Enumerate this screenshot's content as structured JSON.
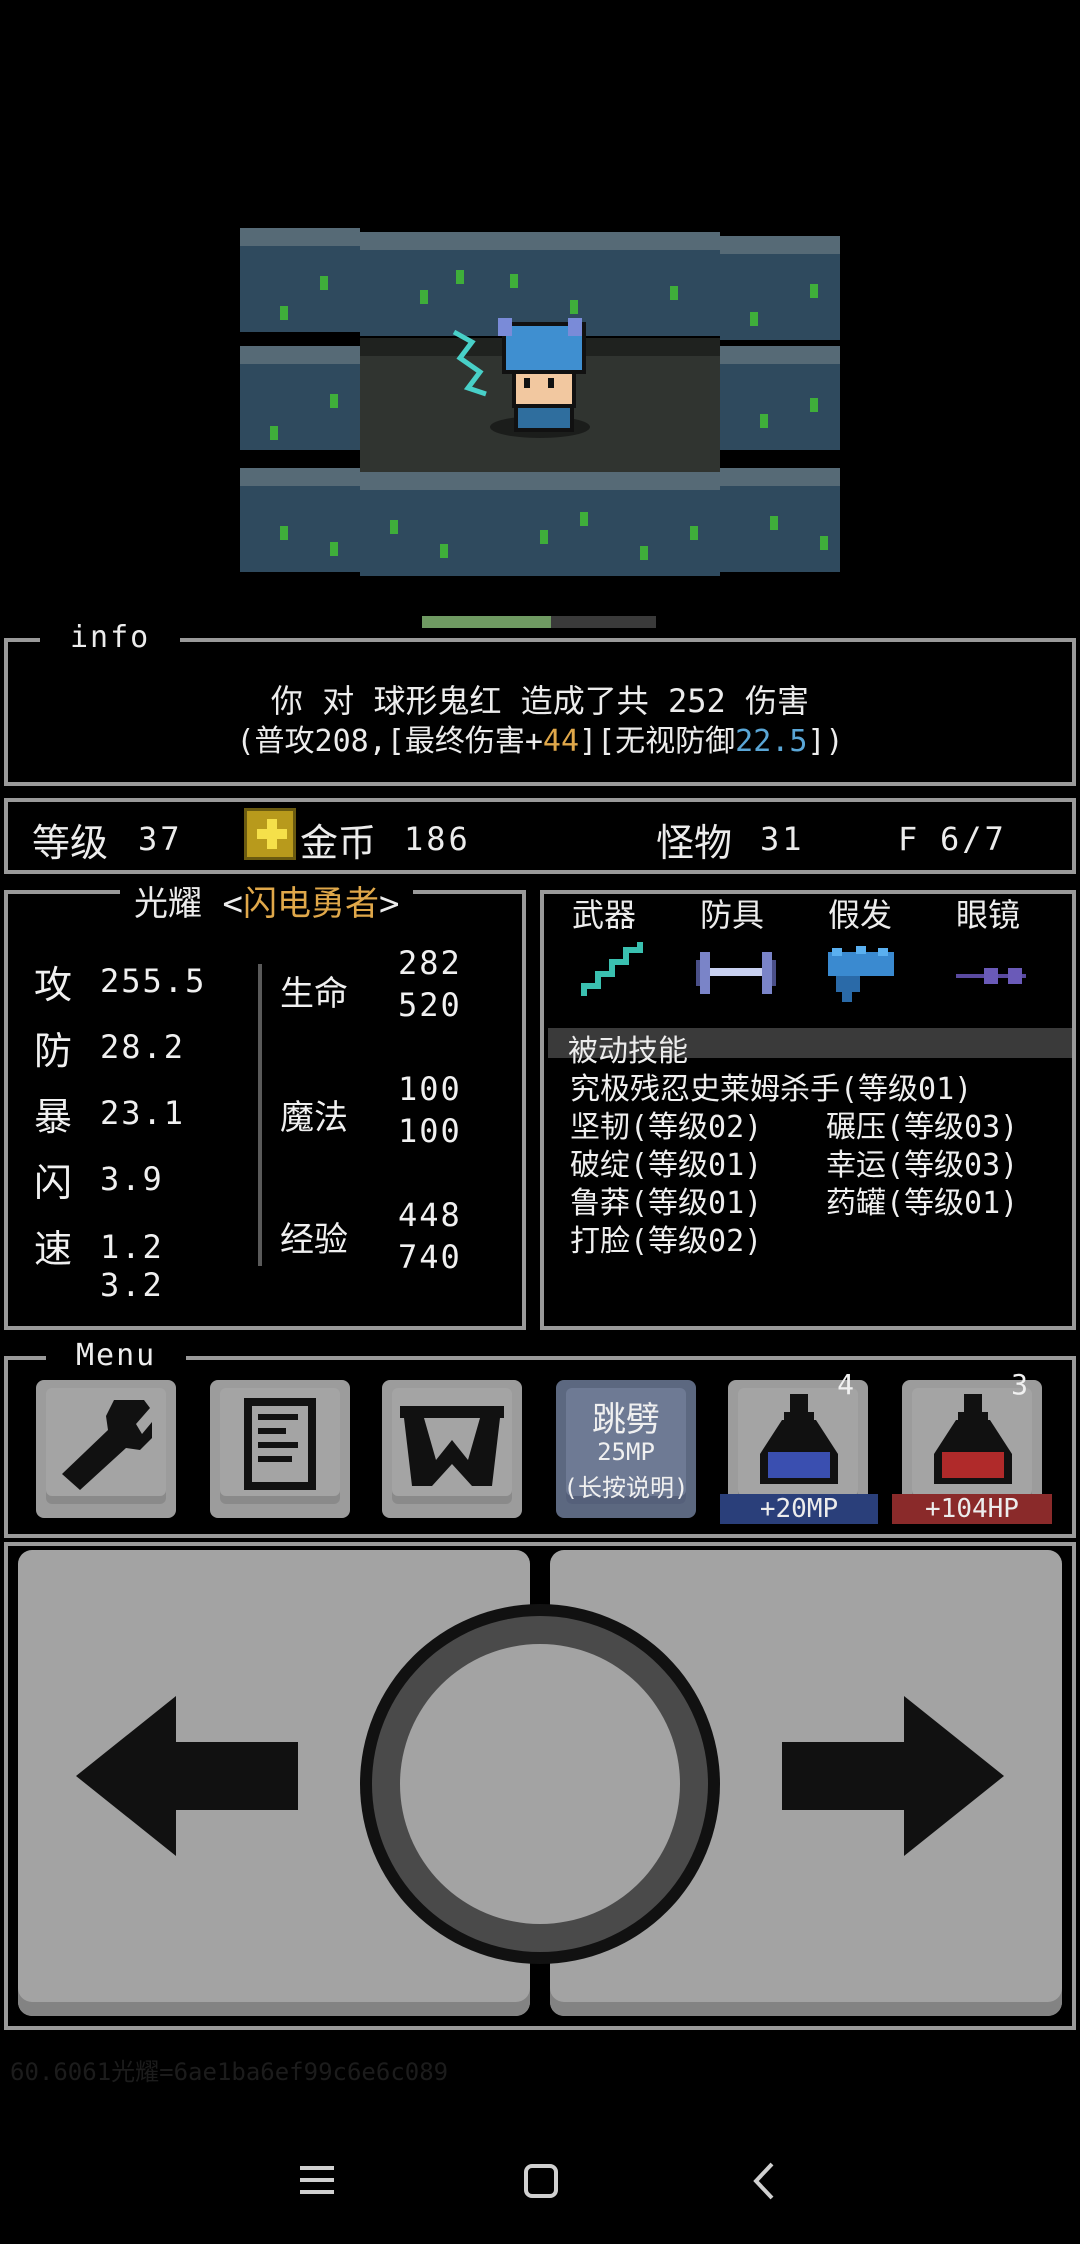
{
  "info": {
    "title": "info",
    "line1": "你 对 球形鬼红 造成了共 252 伤害",
    "line2_prefix": "(普攻208,[最终伤害+",
    "line2_final": "44",
    "line2_mid": "][无视防御",
    "line2_ignore": "22.5",
    "line2_suffix": "])"
  },
  "hp_progress": 0.55,
  "status": {
    "level_label": "等级",
    "level": "37",
    "gold_label": "金币",
    "gold": "186",
    "monster_label": "怪物",
    "monster": "31",
    "floor_label": "F",
    "floor": "6/7"
  },
  "hero": {
    "name": "光耀",
    "title_open": "<",
    "title": "闪电勇者",
    "title_close": ">",
    "atk_label": "攻",
    "atk": "255.5",
    "def_label": "防",
    "def": "28.2",
    "crit_label": "暴",
    "crit": "23.1",
    "dodge_label": "闪",
    "dodge": "3.9",
    "speed_label": "速",
    "speed_a": "1.2",
    "speed_b": "3.2",
    "hp_label": "生命",
    "hp_cur": "282",
    "hp_max": "520",
    "mp_label": "魔法",
    "mp_cur": "100",
    "mp_max": "100",
    "exp_label": "经验",
    "exp_cur": "448",
    "exp_max": "740"
  },
  "equipment": {
    "weapon_label": "武器",
    "armor_label": "防具",
    "wig_label": "假发",
    "glasses_label": "眼镜",
    "passive_label": "被动技能",
    "skills": [
      "究极残忍史莱姆杀手(等级01)",
      "坚韧(等级02)",
      "碾压(等级03)",
      "破绽(等级01)",
      "幸运(等级03)",
      "鲁莽(等级01)",
      "药罐(等级01)",
      "打脸(等级02)"
    ]
  },
  "menu": {
    "title": "Menu",
    "skill_name": "跳劈",
    "skill_cost": "25MP",
    "skill_hint": "(长按说明)",
    "mp_potion_count": "4",
    "mp_potion_label": "+20MP",
    "hp_potion_count": "3",
    "hp_potion_label": "+104HP"
  },
  "debug_text": "60.6061光耀=6ae1ba6ef99c6e6c089",
  "colors": {
    "accent_orange": "#e0a84a",
    "accent_blue": "#5aa6d6",
    "mp_badge": "#2a3f7a",
    "hp_badge": "#8a2a2a"
  },
  "icons": [
    "wrench-icon",
    "notebook-icon",
    "bag-icon",
    "mp-potion-icon",
    "hp-potion-icon",
    "left-arrow-icon",
    "circle-icon",
    "right-arrow-icon",
    "gold-coin-icon",
    "menu-icon",
    "home-icon",
    "back-icon"
  ]
}
